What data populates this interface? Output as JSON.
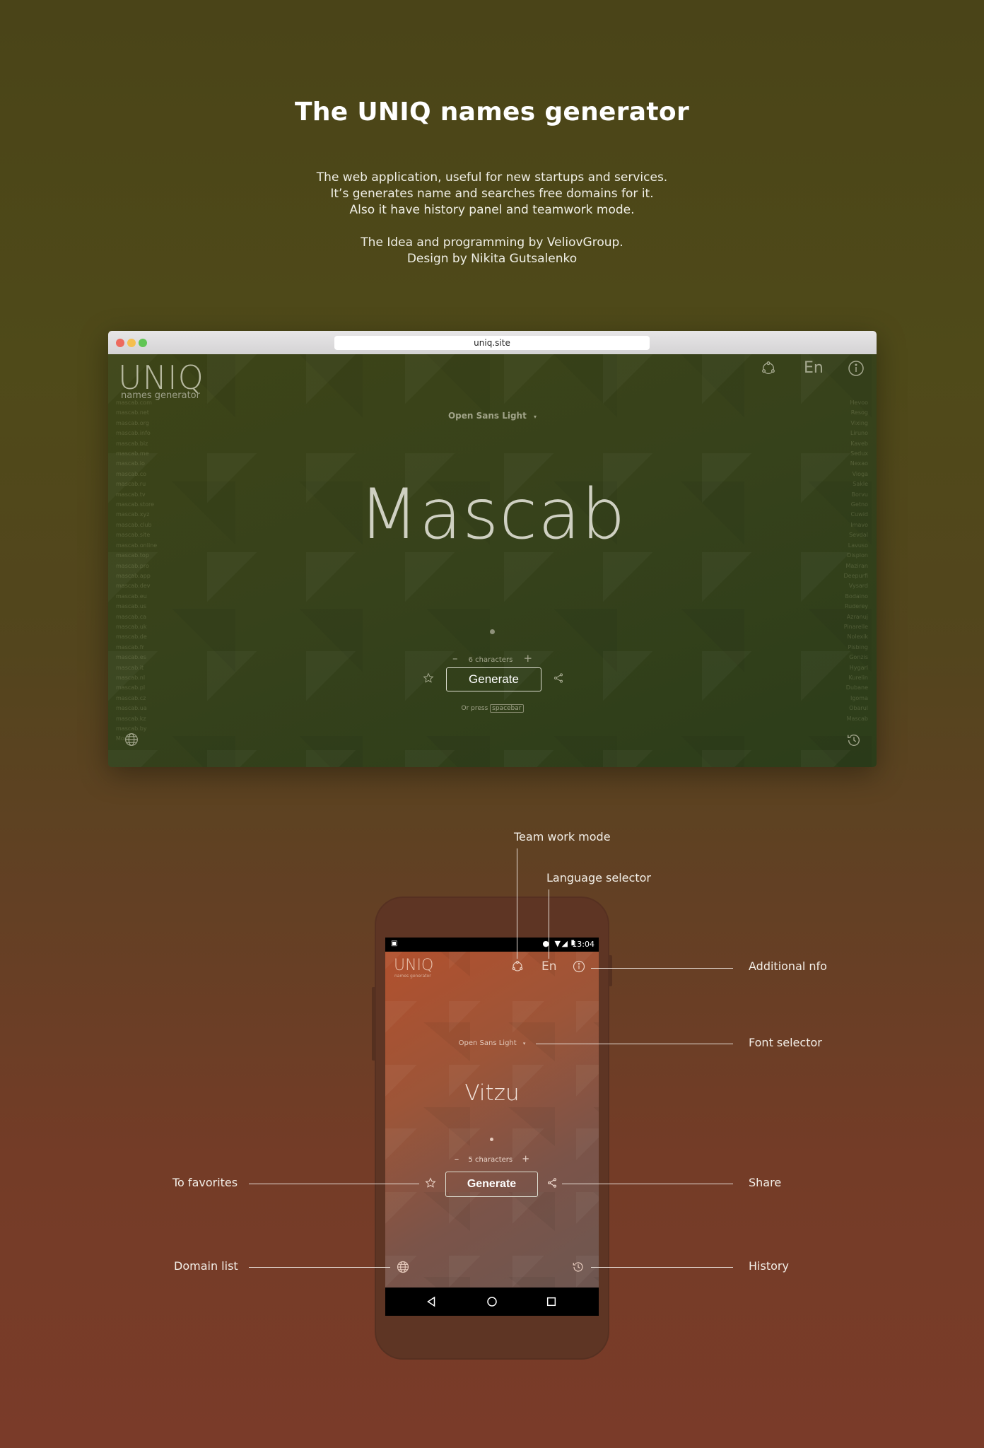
{
  "hero": {
    "title": "The UNIQ names generator",
    "desc_line1": "The web application, useful for new startups and services.",
    "desc_line2": "It’s generates name and searches free domains for it.",
    "desc_line3": "Also it have history panel and teamwork mode.",
    "credit_line1": "The Idea and programming by VeliovGroup.",
    "credit_line2": "Design by Nikita Gutsalenko"
  },
  "browser": {
    "url": "uniq.site",
    "logo": "UNIQ",
    "logo_sub": "names generator",
    "font_selector": "Open Sans Light",
    "word": "Mascab",
    "chars_label": "6 characters",
    "generate_label": "Generate",
    "or_press": "Or press",
    "spacebar": "spacebar",
    "language": "En",
    "domains_left": [
      "mascab.com",
      "mascab.net",
      "mascab.org",
      "mascab.info",
      "mascab.biz",
      "mascab.me",
      "mascab.io",
      "mascab.co",
      "mascab.ru",
      "mascab.tv",
      "mascab.store",
      "mascab.xyz",
      "mascab.club",
      "mascab.site",
      "mascab.online",
      "mascab.top",
      "mascab.pro",
      "mascab.app",
      "mascab.dev",
      "mascab.eu",
      "mascab.us",
      "mascab.ca",
      "mascab.uk",
      "mascab.de",
      "mascab.fr",
      "mascab.es",
      "mascab.it",
      "mascab.nl",
      "mascab.pl",
      "mascab.cz",
      "mascab.ua",
      "mascab.kz",
      "mascab.by",
      "More"
    ],
    "history_right": [
      "Hevoo",
      "Resog",
      "Vixing",
      "Liruno",
      "Kaveb",
      "Sedux",
      "Nexao",
      "Vioga",
      "Sakle",
      "Borvu",
      "Getno",
      "Cuwid",
      "Imavo",
      "Sevdal",
      "Lavuso",
      "Displon",
      "Maziran",
      "Deepurfi",
      "Vysard",
      "Bodaino",
      "Ruderey",
      "Azranuj",
      "Pinarelle",
      "Nolexik",
      "Pisbing",
      "Gonzis",
      "Hygarl",
      "Kurelin",
      "Dubane",
      "Igoma",
      "Obarul",
      "Mascab"
    ],
    "icons": {
      "team": "team-work-icon",
      "info": "info-icon",
      "favorite": "star-icon",
      "share": "share-icon",
      "domains": "globe-icon",
      "history": "history-icon"
    }
  },
  "phone": {
    "time": "13:04",
    "logo": "UNIQ",
    "logo_sub": "names generator",
    "language": "En",
    "font_selector": "Open Sans Light",
    "word": "Vitzu",
    "chars_label": "5 characters",
    "generate_label": "Generate"
  },
  "callouts": {
    "team_work": "Team work mode",
    "language": "Language selector",
    "additional_info": "Additional nfo",
    "font_selector": "Font selector",
    "favorites": "To favorites",
    "share": "Share",
    "domain_list": "Domain list",
    "history": "History"
  },
  "colors": {
    "background_top": "#4a4418",
    "background_bottom": "#7a3b29",
    "browser_app": "#37421b",
    "phone_body": "#5e3524",
    "phone_screen": "#9d5538"
  }
}
